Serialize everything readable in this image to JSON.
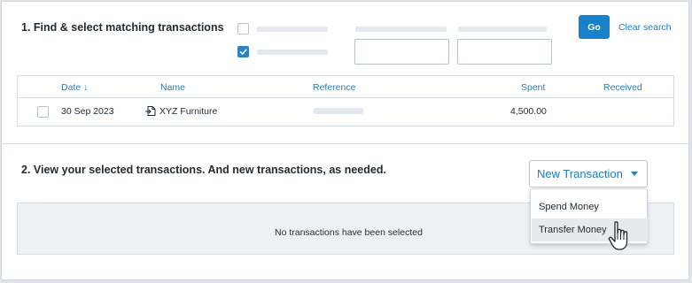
{
  "section1": {
    "title": "1. Find & select matching transactions",
    "go_label": "Go",
    "clear_label": "Clear search"
  },
  "table": {
    "columns": {
      "date": "Date ↓",
      "name": "Name",
      "reference": "Reference",
      "spent": "Spent",
      "received": "Received"
    },
    "rows": [
      {
        "checked": false,
        "date": "30 Sep 2023",
        "name": "XYZ Furniture",
        "spent": "4,500.00",
        "received": ""
      }
    ]
  },
  "section2": {
    "title": "2. View your selected transactions. And new transactions, as needed.",
    "new_transaction_label": "New Transaction",
    "menu_items": [
      "Spend Money",
      "Transfer Money"
    ],
    "empty_text": "No transactions have been selected"
  },
  "colors": {
    "accent": "#1682cc",
    "link": "#1a7fc4"
  },
  "icons": {
    "row_name_icon": "transaction-icon",
    "cursor": "hand-pointer-icon"
  }
}
